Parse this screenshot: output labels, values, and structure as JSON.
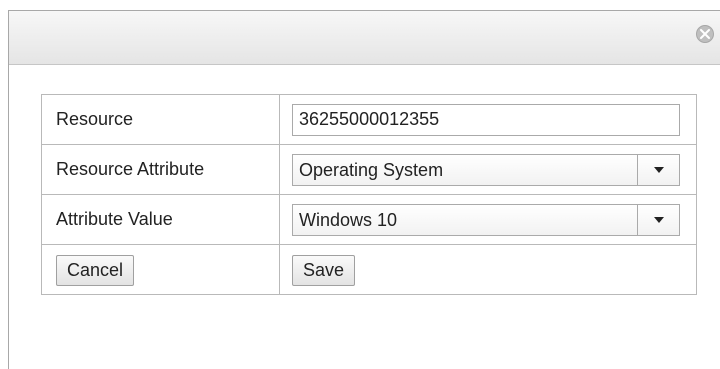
{
  "form": {
    "rows": [
      {
        "label": "Resource",
        "value": "36255000012355"
      },
      {
        "label": "Resource Attribute",
        "value": "Operating System"
      },
      {
        "label": "Attribute Value",
        "value": "Windows 10"
      }
    ],
    "cancel_label": "Cancel",
    "save_label": "Save"
  },
  "icons": {
    "close": "close-icon",
    "dropdown": "chevron-down-icon"
  },
  "colors": {
    "titlebar": "#e9e9e9",
    "border": "#b9b9b9",
    "text": "#222222"
  }
}
